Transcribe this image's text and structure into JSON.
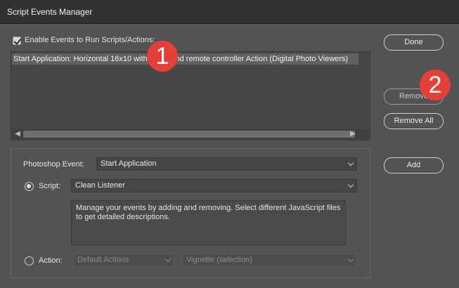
{
  "window": {
    "title": "Script Events Manager"
  },
  "enable_events": {
    "label": "Enable Events to Run Scripts/Actions:",
    "checked": true
  },
  "event_list": {
    "items": [
      "Start Application: Horizontal 16x10 with tripod and remote controller Action (Digital Photo Viewers)"
    ]
  },
  "buttons": {
    "done": "Done",
    "remove": "Remove",
    "remove_all": "Remove All",
    "add": "Add"
  },
  "form": {
    "photoshop_event_label": "Photoshop Event:",
    "photoshop_event_value": "Start Application",
    "script_label": "Script:",
    "script_value": "Clean Listener",
    "description": "Manage your events by adding and removing. Select different JavaScript files to get detailed descriptions.",
    "action_label": "Action:",
    "action_set_value": "Default Actions",
    "action_value": "Vignette (selection)"
  },
  "markers": {
    "first": "1",
    "second": "2"
  },
  "colors": {
    "background": "#535353",
    "titlebar": "#323232",
    "marker": "#e63f37"
  }
}
